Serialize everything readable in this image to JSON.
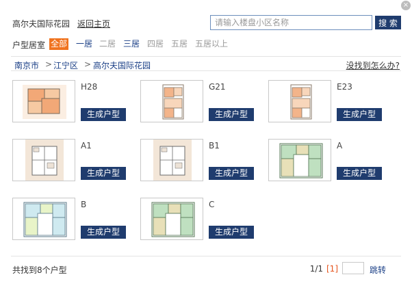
{
  "dialog": {
    "close_glyph": "×"
  },
  "header": {
    "estate_name": "高尔夫国际花园",
    "back_link": "返回主页",
    "search_placeholder": "请输入楼盘小区名称",
    "search_button": "搜 索"
  },
  "filters": {
    "label": "户型居室",
    "items": [
      {
        "label": "全部",
        "state": "selected"
      },
      {
        "label": "一居",
        "state": "active"
      },
      {
        "label": "二居",
        "state": "inactive"
      },
      {
        "label": "三居",
        "state": "active"
      },
      {
        "label": "四居",
        "state": "inactive"
      },
      {
        "label": "五居",
        "state": "inactive"
      },
      {
        "label": "五居以上",
        "state": "inactive"
      }
    ]
  },
  "breadcrumb": {
    "city": "南京市",
    "district": "江宁区",
    "estate": "高尔夫国际花园",
    "separator": ">",
    "help_link": "没找到怎么办?"
  },
  "floorplans": [
    {
      "name": "H28",
      "button": "生成户型",
      "style": "orange"
    },
    {
      "name": "G21",
      "button": "生成户型",
      "style": "orange-small"
    },
    {
      "name": "E23",
      "button": "生成户型",
      "style": "orange-small"
    },
    {
      "name": "A1",
      "button": "生成户型",
      "style": "beige"
    },
    {
      "name": "B1",
      "button": "生成户型",
      "style": "beige"
    },
    {
      "name": "A",
      "button": "生成户型",
      "style": "green"
    },
    {
      "name": "B",
      "button": "生成户型",
      "style": "cyan"
    },
    {
      "name": "C",
      "button": "生成户型",
      "style": "green"
    }
  ],
  "footer": {
    "found_text": "共找到8个户型",
    "page_info": "1/1",
    "page_current": "[1]",
    "jump_label": "跳转"
  },
  "colors": {
    "navy_button": "#1f3c6e",
    "orange_selected": "#f0731f",
    "link_blue": "#1a3f86"
  }
}
